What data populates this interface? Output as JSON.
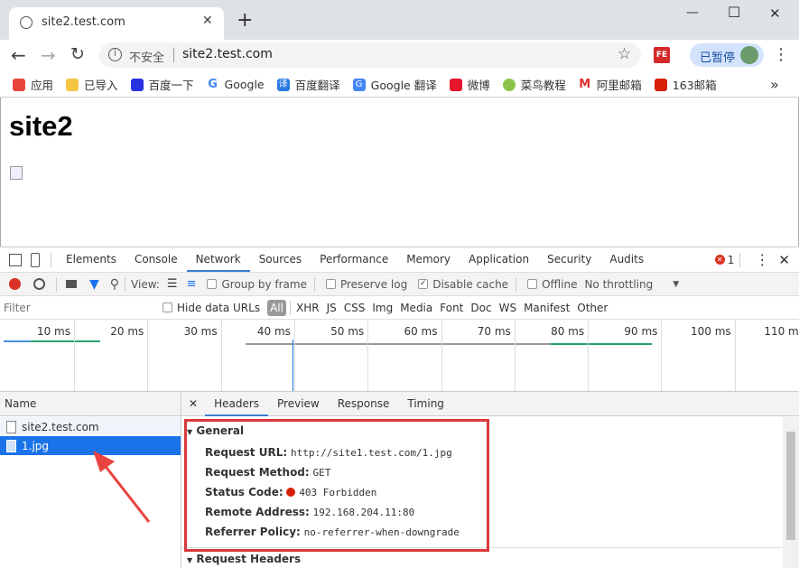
{
  "browser": {
    "tab_title": "site2.test.com",
    "new_tab": "+",
    "window_controls": {
      "minimize": "—",
      "maximize": "☐",
      "close": "✕"
    },
    "security_label": "不安全",
    "url": "site2.test.com",
    "profile_label": "已暂停",
    "extension_label": "FE",
    "bookmarks": [
      {
        "label": "应用",
        "icon": "apps-icon",
        "color": "#e8453c"
      },
      {
        "label": "已导入",
        "icon": "folder-icon",
        "color": "#f5c542"
      },
      {
        "label": "百度一下",
        "icon": "baidu-icon",
        "color": "#2932e1"
      },
      {
        "label": "Google",
        "icon": "google-icon",
        "color": "#4285f4"
      },
      {
        "label": "百度翻译",
        "icon": "translate-icon",
        "color": "#2a7ae2"
      },
      {
        "label": "Google 翻译",
        "icon": "google-translate-icon",
        "color": "#4285f4"
      },
      {
        "label": "微博",
        "icon": "weibo-icon",
        "color": "#e6162d"
      },
      {
        "label": "菜鸟教程",
        "icon": "runoob-icon",
        "color": "#8bc34a"
      },
      {
        "label": "阿里邮箱",
        "icon": "mail-icon",
        "color": "#e02d2d"
      },
      {
        "label": "163邮箱",
        "icon": "163-icon",
        "color": "#d81e06"
      }
    ],
    "more_bookmarks": "»"
  },
  "page": {
    "heading": "site2"
  },
  "devtools": {
    "tabs": [
      "Elements",
      "Console",
      "Network",
      "Sources",
      "Performance",
      "Memory",
      "Application",
      "Security",
      "Audits"
    ],
    "active_tab": "Network",
    "error_count": "1",
    "toolbar": {
      "view_label": "View:",
      "group_by_frame": "Group by frame",
      "preserve_log": "Preserve log",
      "disable_cache": "Disable cache",
      "offline": "Offline",
      "throttling": "No throttling"
    },
    "filter": {
      "placeholder": "Filter",
      "hide_data_urls": "Hide data URLs",
      "types": [
        "All",
        "XHR",
        "JS",
        "CSS",
        "Img",
        "Media",
        "Font",
        "Doc",
        "WS",
        "Manifest",
        "Other"
      ]
    },
    "timeline_labels": [
      "10 ms",
      "20 ms",
      "30 ms",
      "40 ms",
      "50 ms",
      "60 ms",
      "70 ms",
      "80 ms",
      "90 ms",
      "100 ms",
      "110 ms"
    ],
    "name_header": "Name",
    "requests": [
      {
        "name": "site2.test.com",
        "selected": false
      },
      {
        "name": "1.jpg",
        "selected": true
      }
    ],
    "detail_tabs": [
      "Headers",
      "Preview",
      "Response",
      "Timing"
    ],
    "general": {
      "title": "General",
      "rows": [
        {
          "key": "Request URL:",
          "value": "http://site1.test.com/1.jpg"
        },
        {
          "key": "Request Method:",
          "value": "GET"
        },
        {
          "key": "Status Code:",
          "value": "403 Forbidden",
          "status_color": "#d81e06"
        },
        {
          "key": "Remote Address:",
          "value": "192.168.204.11:80"
        },
        {
          "key": "Referrer Policy:",
          "value": "no-referrer-when-downgrade"
        }
      ]
    },
    "request_headers_title": "Request Headers"
  },
  "colors": {
    "accent": "#3b7ed0",
    "annotation": "#d9383a",
    "selected_row": "#1a73e8"
  }
}
